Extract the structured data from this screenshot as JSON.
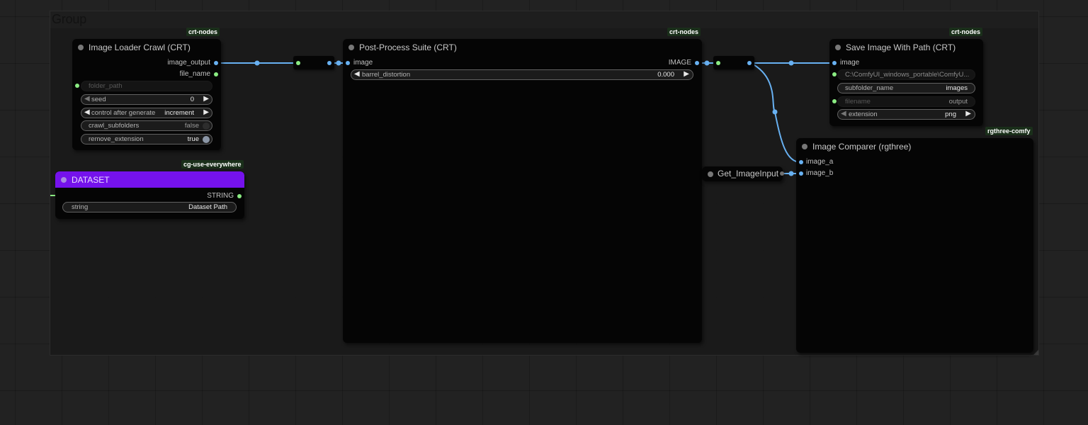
{
  "group": {
    "title": "Group"
  },
  "colors": {
    "wire_image": "#68b1f2",
    "socket_string": "#8aeb82",
    "dataset_header": "#7512ec",
    "canvas_bg": "#222222"
  },
  "nodes": {
    "image_loader": {
      "badge": "crt-nodes",
      "title": "Image Loader Crawl (CRT)",
      "outputs": [
        "image_output",
        "file_name"
      ],
      "widgets": {
        "folder_path": {
          "label": "folder_path"
        },
        "seed": {
          "label": "seed",
          "value": "0"
        },
        "control_after_generate": {
          "label": "control after generate",
          "value": "increment"
        },
        "crawl_subfolders": {
          "label": "crawl_subfolders",
          "value": "false"
        },
        "remove_extension": {
          "label": "remove_extension",
          "value": "true"
        }
      }
    },
    "dataset": {
      "badge": "cg-use-everywhere",
      "title": "DATASET",
      "output": "STRING",
      "widget": {
        "label": "string",
        "value": "Dataset Path"
      }
    },
    "post_process": {
      "badge": "crt-nodes",
      "title": "Post-Process Suite (CRT)",
      "input": "image",
      "output": "IMAGE",
      "widget": {
        "label": "barrel_distortion",
        "value": "0.000"
      }
    },
    "save_image": {
      "badge": "crt-nodes",
      "title": "Save Image With Path (CRT)",
      "input": "image",
      "widgets": {
        "path": {
          "value": "C:\\ComfyUI_windows_portable\\ComfyU..."
        },
        "subfolder_name": {
          "label": "subfolder_name",
          "value": "images"
        },
        "filename": {
          "label": "filename",
          "value": "output"
        },
        "extension": {
          "label": "extension",
          "value": "png"
        }
      }
    },
    "image_comparer": {
      "badge": "rgthree-comfy",
      "title": "Image Comparer (rgthree)",
      "inputs": [
        "image_a",
        "image_b"
      ]
    },
    "get_image_input": {
      "title": "Get_ImageInput"
    }
  }
}
